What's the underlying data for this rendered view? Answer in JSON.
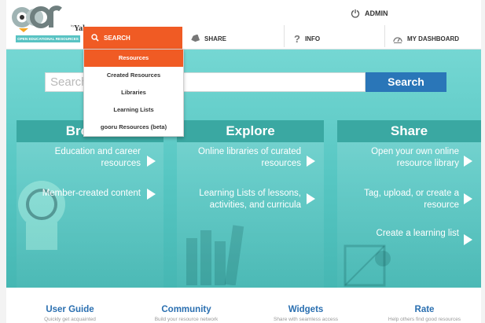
{
  "header": {
    "logo_text": "oer",
    "logo_band": "OPEN EDUCATIONAL RESOURCES",
    "logo_by": "by",
    "logo_yale": "Yale",
    "admin_label": "ADMIN",
    "nav": {
      "search": "SEARCH",
      "share": "SHARE",
      "info": "INFO",
      "dashboard": "MY DASHBOARD"
    }
  },
  "dropdown": {
    "items": [
      "Resources",
      "Created Resources",
      "Libraries",
      "Learning Lists",
      "gooru Resources (beta)"
    ],
    "active_index": 0
  },
  "search": {
    "placeholder": "Search",
    "button_label": "Search"
  },
  "columns": [
    {
      "title": "Browse",
      "items": [
        "Education and career resources",
        "Member-created content"
      ]
    },
    {
      "title": "Explore",
      "items": [
        "Online libraries of curated resources",
        "Learning Lists of lessons, activities, and curricula"
      ]
    },
    {
      "title": "Share",
      "items": [
        "Open your own online resource library",
        "Tag, upload, or create a resource",
        "Create a learning list"
      ]
    }
  ],
  "footer": [
    {
      "title": "User Guide",
      "subtitle": "Quickly get acquainted"
    },
    {
      "title": "Community",
      "subtitle": "Build your resource network"
    },
    {
      "title": "Widgets",
      "subtitle": "Share with seamless access"
    },
    {
      "title": "Rate",
      "subtitle": "Help others find good resources"
    }
  ],
  "colors": {
    "accent_orange": "#f05b24",
    "teal": "#56c6c2",
    "search_blue": "#2a76b8",
    "link_blue": "#2a6fb0"
  }
}
